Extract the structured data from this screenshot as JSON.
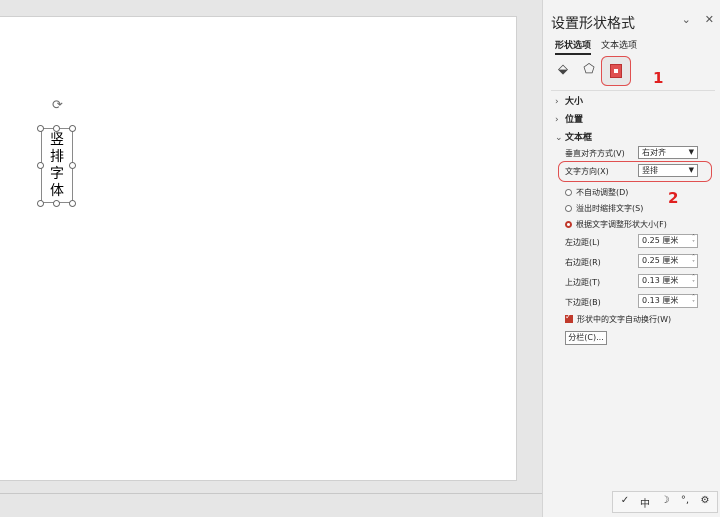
{
  "shape": {
    "chars": [
      "竖",
      "排",
      "字",
      "体"
    ]
  },
  "pane": {
    "title": "设置形状格式",
    "tabs": [
      "形状选项",
      "文本选项"
    ],
    "sections": {
      "size": "大小",
      "position": "位置",
      "textbox": "文本框"
    },
    "vertical_align": {
      "label": "垂直对齐方式(V)",
      "value": "右对齐"
    },
    "text_direction": {
      "label": "文字方向(X)",
      "value": "竖排"
    },
    "autofit": {
      "options": [
        "不自动调整(D)",
        "溢出时缩排文字(S)",
        "根据文字调整形状大小(F)"
      ],
      "selected_index": 2
    },
    "margins": [
      {
        "label": "左边距(L)",
        "value": "0.25 厘米"
      },
      {
        "label": "右边距(R)",
        "value": "0.25 厘米"
      },
      {
        "label": "上边距(T)",
        "value": "0.13 厘米"
      },
      {
        "label": "下边距(B)",
        "value": "0.13 厘米"
      }
    ],
    "wrap_text": {
      "label": "形状中的文字自动换行(W)",
      "checked": true
    },
    "columns_button": "分栏(C)...",
    "annotations": [
      "1",
      "2"
    ]
  },
  "ime": {
    "items": [
      "✓",
      "中",
      "☽",
      "°,",
      "⚙"
    ]
  },
  "colors": {
    "accent": "#c0392b",
    "annotation": "#e02020"
  }
}
